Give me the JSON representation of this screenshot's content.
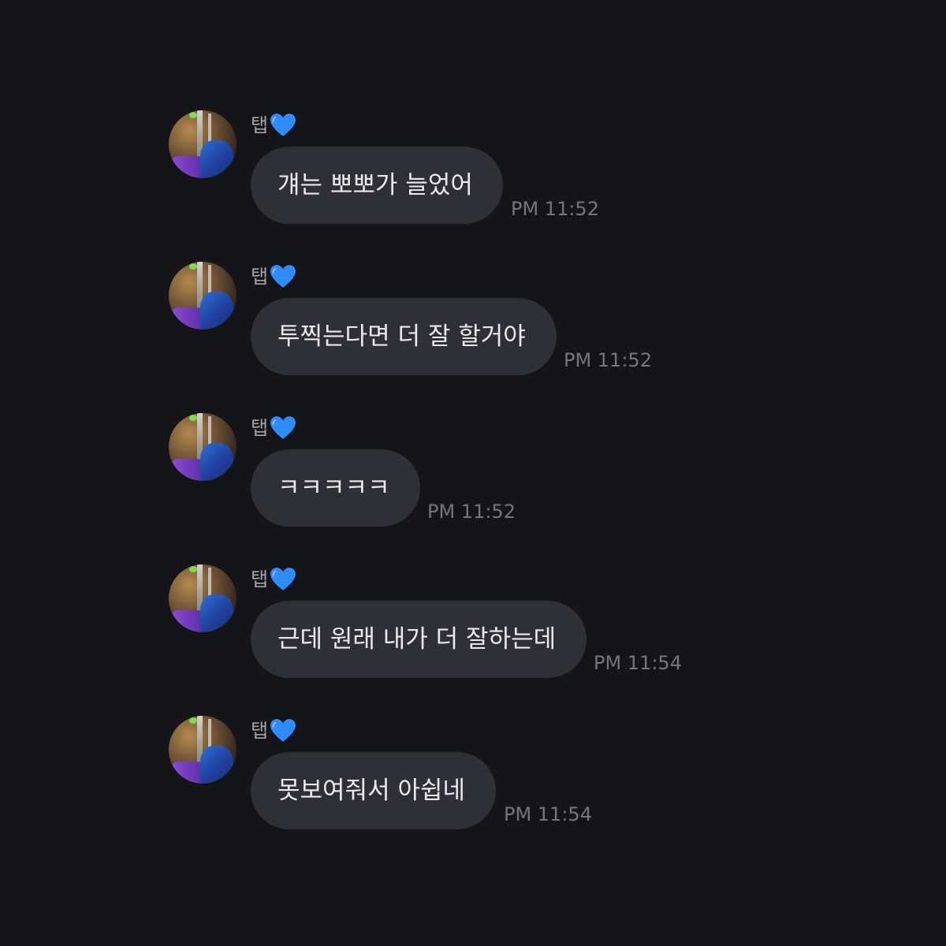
{
  "colors": {
    "background": "#141519",
    "bubble": "#2e3037",
    "bubble_text": "#e9eaee",
    "sender_name": "#a2a4aa",
    "timestamp": "#74767d",
    "heart": "#2f8bff"
  },
  "messages": [
    {
      "sender": "탭",
      "sender_icon": "blue-heart-icon",
      "text": "걔는 뽀뽀가 늘었어",
      "time": "PM 11:52"
    },
    {
      "sender": "탭",
      "sender_icon": "blue-heart-icon",
      "text": "투찍는다면 더 잘 할거야",
      "time": "PM 11:52"
    },
    {
      "sender": "탭",
      "sender_icon": "blue-heart-icon",
      "text": "ㅋㅋㅋㅋㅋ",
      "time": "PM 11:52"
    },
    {
      "sender": "탭",
      "sender_icon": "blue-heart-icon",
      "text": "근데 원래 내가 더 잘하는데",
      "time": "PM 11:54"
    },
    {
      "sender": "탭",
      "sender_icon": "blue-heart-icon",
      "text": "못보여줘서 아쉽네",
      "time": "PM 11:54"
    }
  ]
}
